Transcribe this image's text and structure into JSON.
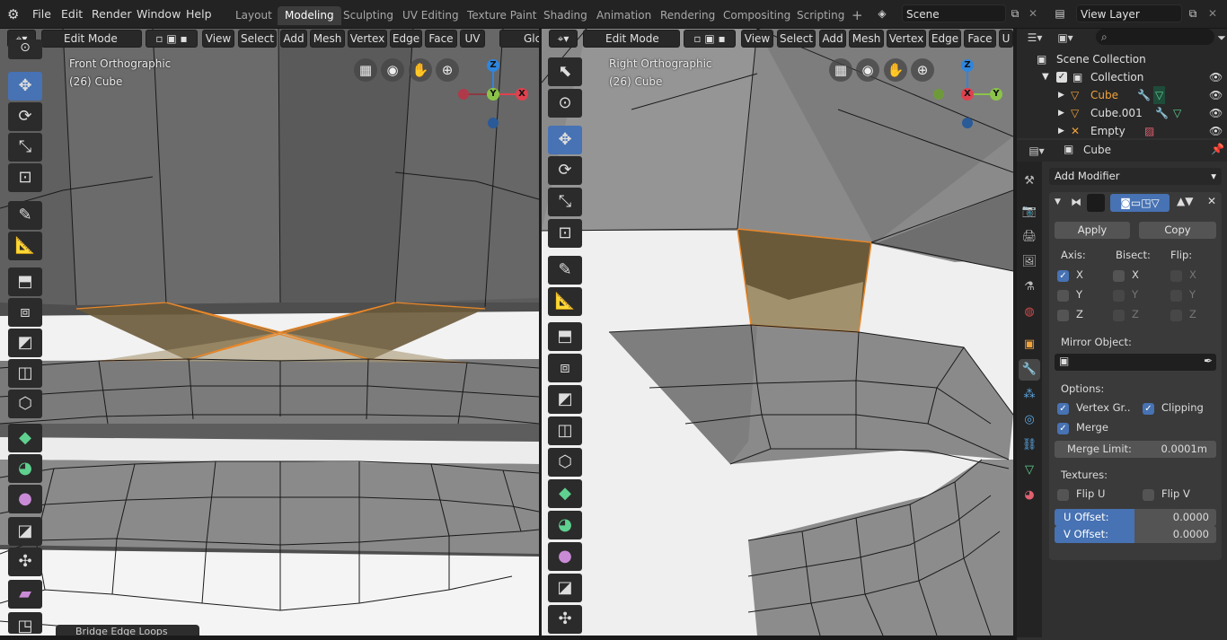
{
  "topbar": {
    "menus": [
      "File",
      "Edit",
      "Render",
      "Window",
      "Help"
    ],
    "workspaces": [
      "Layout",
      "Modeling",
      "Sculpting",
      "UV Editing",
      "Texture Paint",
      "Shading",
      "Animation",
      "Rendering",
      "Compositing",
      "Scripting"
    ],
    "add_tab": "+",
    "scene": "Scene",
    "view_layer": "View Layer"
  },
  "viewport_left": {
    "mode": "Edit Mode",
    "menus": [
      "View",
      "Select",
      "Add",
      "Mesh",
      "Vertex",
      "Edge",
      "Face",
      "UV"
    ],
    "transform_cut": "Glc",
    "view_name": "Front Orthographic",
    "object_info": "(26) Cube",
    "gizmo": {
      "z": "Z",
      "y": "Y",
      "x": "X"
    },
    "bottom_panel": "Bridge Edge Loops"
  },
  "viewport_right": {
    "mode": "Edit Mode",
    "menus": [
      "View",
      "Select",
      "Add",
      "Mesh",
      "Vertex",
      "Edge",
      "Face"
    ],
    "menu_cut": "U",
    "view_name": "Right Orthographic",
    "object_info": "(26) Cube",
    "gizmo": {
      "z": "Z",
      "x": "X",
      "y": "Y"
    }
  },
  "outliner": {
    "root": "Scene Collection",
    "collection": "Collection",
    "objects": [
      "Cube",
      "Cube.001",
      "Empty"
    ]
  },
  "properties": {
    "object_name": "Cube",
    "add_modifier": "Add Modifier",
    "apply": "Apply",
    "copy": "Copy",
    "axis_label": "Axis:",
    "bisect_label": "Bisect:",
    "flip_label": "Flip:",
    "axes": [
      "X",
      "Y",
      "Z"
    ],
    "axis_checked": [
      true,
      false,
      false
    ],
    "mirror_object_label": "Mirror Object:",
    "options_label": "Options:",
    "vertex_groups": "Vertex Gr..",
    "clipping": "Clipping",
    "merge": "Merge",
    "merge_limit_label": "Merge Limit:",
    "merge_limit_value": "0.0001m",
    "textures_label": "Textures:",
    "flip_u": "Flip U",
    "flip_v": "Flip V",
    "u_offset_label": "U Offset:",
    "u_offset_value": "0.0000",
    "v_offset_label": "V Offset:",
    "v_offset_value": "0.0000"
  },
  "colors": {
    "accent": "#4772b3",
    "selection": "#e8872a",
    "x_axis": "#e0414f",
    "y_axis": "#8bc34a",
    "z_axis": "#2e86de",
    "active_object": "#f2a33a"
  }
}
